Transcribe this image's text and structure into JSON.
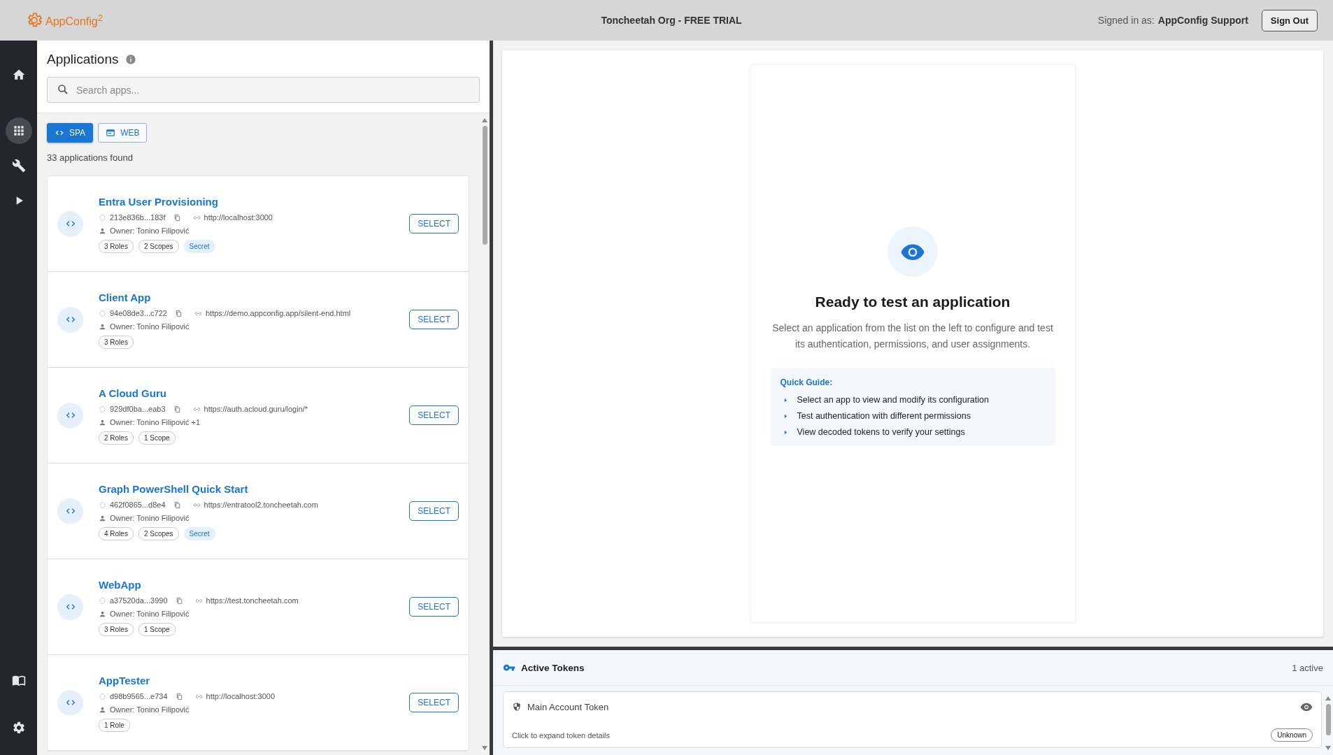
{
  "header": {
    "logo": "AppConfig$^{2}$",
    "org": "Toncheetah Org - FREE TRIAL",
    "signed_in_label": "Signed in as:",
    "signed_in_user": "AppConfig Support",
    "sign_out": "Sign Out"
  },
  "sidebar": {
    "items": [
      {
        "kind": "home",
        "selected": false
      },
      {
        "kind": "apps",
        "selected": true
      },
      {
        "kind": "tools",
        "selected": false
      },
      {
        "kind": "run",
        "selected": false
      }
    ],
    "bottom_items": [
      {
        "kind": "docs",
        "selected": false
      },
      {
        "kind": "settings",
        "selected": false
      }
    ]
  },
  "applications": {
    "title": "Applications",
    "search": {
      "placeholder": "Search apps..."
    },
    "filters": [
      {
        "label": "SPA",
        "kind": "spa",
        "selected": true
      },
      {
        "label": "WEB",
        "kind": "web",
        "selected": false
      }
    ],
    "count": "33 applications found",
    "apps": [
      {
        "name": "Entra User Provisioning",
        "id": "213e836b...183f",
        "url": "http://localhost:3000",
        "owner": "Owner: Tonino Filipović",
        "tags": [
          {
            "label": "3 Roles",
            "kind": "count"
          },
          {
            "label": "2 Scopes",
            "kind": "count"
          },
          {
            "label": "Secret",
            "kind": "secret"
          }
        ],
        "action": "SELECT"
      },
      {
        "name": "Client App",
        "id": "94e08de3...c722",
        "url": "https://demo.appconfig.app/silent-end.html",
        "owner": "Owner: Tonino Filipović",
        "tags": [
          {
            "label": "3 Roles",
            "kind": "count"
          }
        ],
        "action": "SELECT"
      },
      {
        "name": "A Cloud Guru",
        "id": "929df0ba...eab3",
        "url": "https://auth.acloud.guru/login/*",
        "owner": "Owner: Tonino Filipović +1",
        "tags": [
          {
            "label": "2 Roles",
            "kind": "count"
          },
          {
            "label": "1 Scope",
            "kind": "count"
          }
        ],
        "action": "SELECT"
      },
      {
        "name": "Graph PowerShell Quick Start",
        "id": "462f0865...d8e4",
        "url": "https://entratool2.toncheetah.com",
        "owner": "Owner: Tonino Filipović",
        "tags": [
          {
            "label": "4 Roles",
            "kind": "count"
          },
          {
            "label": "2 Scopes",
            "kind": "count"
          },
          {
            "label": "Secret",
            "kind": "secret"
          }
        ],
        "action": "SELECT"
      },
      {
        "name": "WebApp",
        "id": "a37520da...3990",
        "url": "https://test.toncheetah.com",
        "owner": "Owner: Tonino Filipović",
        "tags": [
          {
            "label": "3 Roles",
            "kind": "count"
          },
          {
            "label": "1 Scope",
            "kind": "count"
          }
        ],
        "action": "SELECT"
      },
      {
        "name": "AppTester",
        "id": "d98b9565...e734",
        "url": "http://localhost:3000",
        "owner": "Owner: Tonino Filipović",
        "tags": [
          {
            "label": "1 Role",
            "kind": "count"
          }
        ],
        "action": "SELECT"
      }
    ]
  },
  "empty_state": {
    "heading": "Ready to test an application",
    "description": "Select an application from the list on the left to configure and test its authentication, permissions, and user assignments.",
    "guide_title": "Quick Guide:",
    "guide_items": [
      "Select an app to view and modify its configuration",
      "Test authentication with different permissions",
      "View decoded tokens to verify your settings"
    ]
  },
  "active_tokens": {
    "title": "Active Tokens",
    "count": "1 active",
    "tokens": [
      {
        "name": "Main Account Token",
        "hint": "Click to expand token details",
        "status": "Unknown"
      }
    ]
  }
}
